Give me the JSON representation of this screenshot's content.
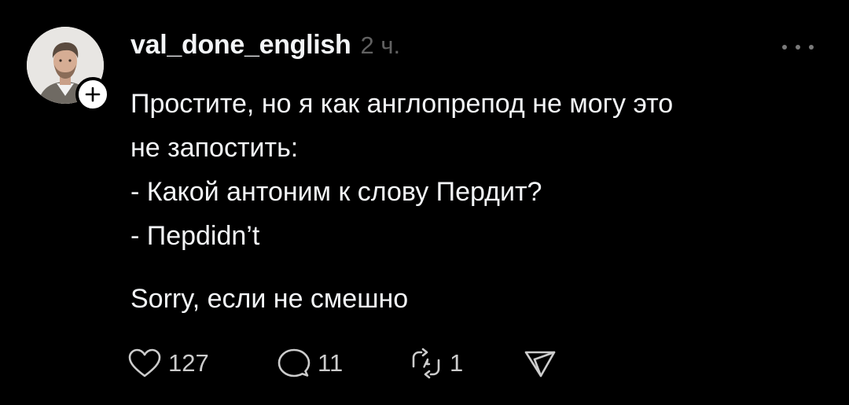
{
  "post": {
    "author": {
      "username": "val_done_english",
      "avatar_icon": "user-avatar",
      "follow_icon": "plus-icon"
    },
    "timestamp": "2 ч.",
    "more_icon": "more-horizontal-icon",
    "text_lines": [
      "Простите, но я как англопрепод не могу это",
      "не запостить:",
      "- Какой антоним к слову Пердит?",
      "- Пepdidn’t"
    ],
    "text_paragraph_2": "Sorry, если не смешно",
    "actions": {
      "likes": "127",
      "replies": "11",
      "reposts": "1"
    }
  },
  "colors": {
    "background": "#000000",
    "text": "#f3f5f7",
    "secondary_text": "#616161",
    "icon": "#cccccc"
  }
}
